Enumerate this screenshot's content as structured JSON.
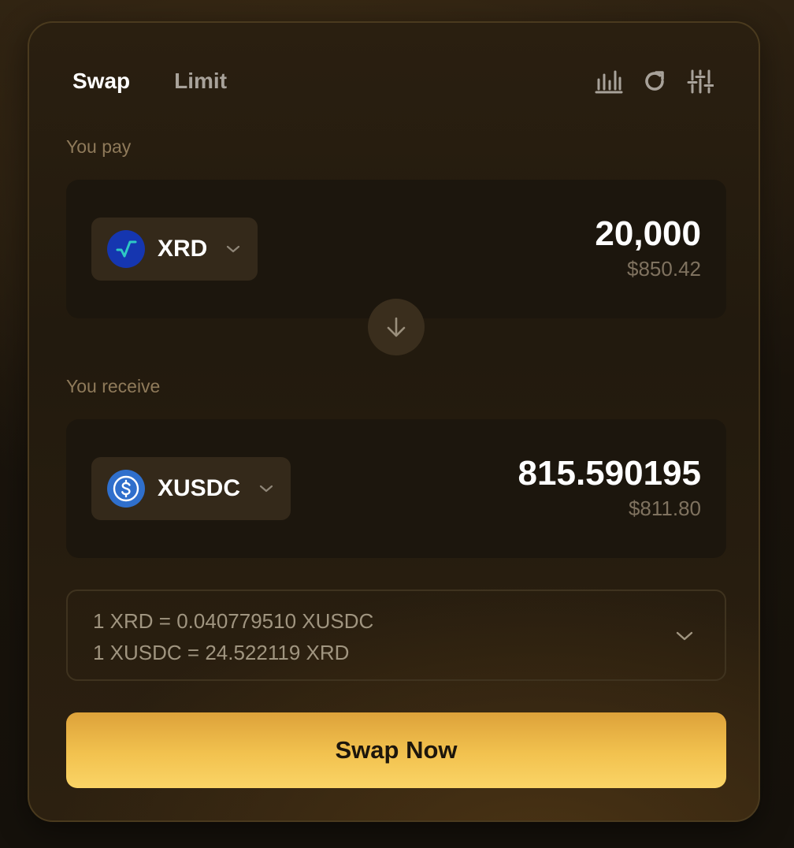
{
  "tabs": [
    {
      "label": "Swap",
      "active": true
    },
    {
      "label": "Limit",
      "active": false
    }
  ],
  "toolbar": {
    "icons": [
      "bar-chart-icon",
      "refresh-icon",
      "sliders-icon"
    ],
    "icon_color": "#a8a29a"
  },
  "pay": {
    "label": "You pay",
    "token": {
      "symbol": "XRD",
      "logo_color": "#1536b0",
      "logo_mark_color": "#2ec9c4"
    },
    "amount": "20,000",
    "fiat": "$850.42"
  },
  "receive": {
    "label": "You receive",
    "token": {
      "symbol": "XUSDC",
      "logo_color": "#2f6fcc"
    },
    "amount": "815.590195",
    "fiat": "$811.80"
  },
  "rate": {
    "line1": "1 XRD = 0.040779510 XUSDC",
    "line2": "1 XUSDC = 24.522119 XRD"
  },
  "action": {
    "label": "Swap Now",
    "gradient_top": "#dda23a",
    "gradient_bottom": "#fad466"
  }
}
